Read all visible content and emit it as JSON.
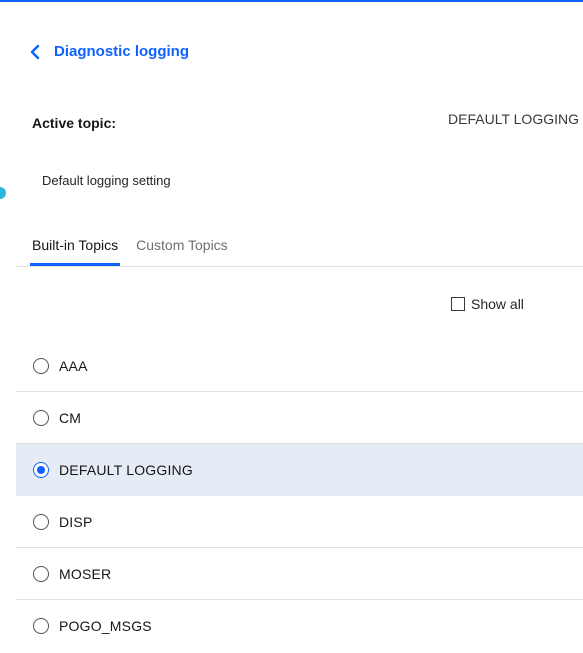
{
  "header": {
    "back_label": "Diagnostic logging"
  },
  "active_topic": {
    "label": "Active topic:",
    "value": "DEFAULT LOGGING"
  },
  "setting": {
    "text": "Default logging setting"
  },
  "tabs": [
    {
      "label": "Built-in Topics",
      "active": true
    },
    {
      "label": "Custom Topics",
      "active": false
    }
  ],
  "show_all": {
    "label": "Show all",
    "checked": false
  },
  "topics": [
    {
      "label": "AAA",
      "selected": false
    },
    {
      "label": "CM",
      "selected": false
    },
    {
      "label": "DEFAULT LOGGING",
      "selected": true
    },
    {
      "label": "DISP",
      "selected": false
    },
    {
      "label": "MOSER",
      "selected": false
    },
    {
      "label": "POGO_MSGS",
      "selected": false
    }
  ],
  "colors": {
    "accent": "#0f62fe",
    "selected_row": "#e6ecf5",
    "status_dot": "#2ab6d8"
  }
}
